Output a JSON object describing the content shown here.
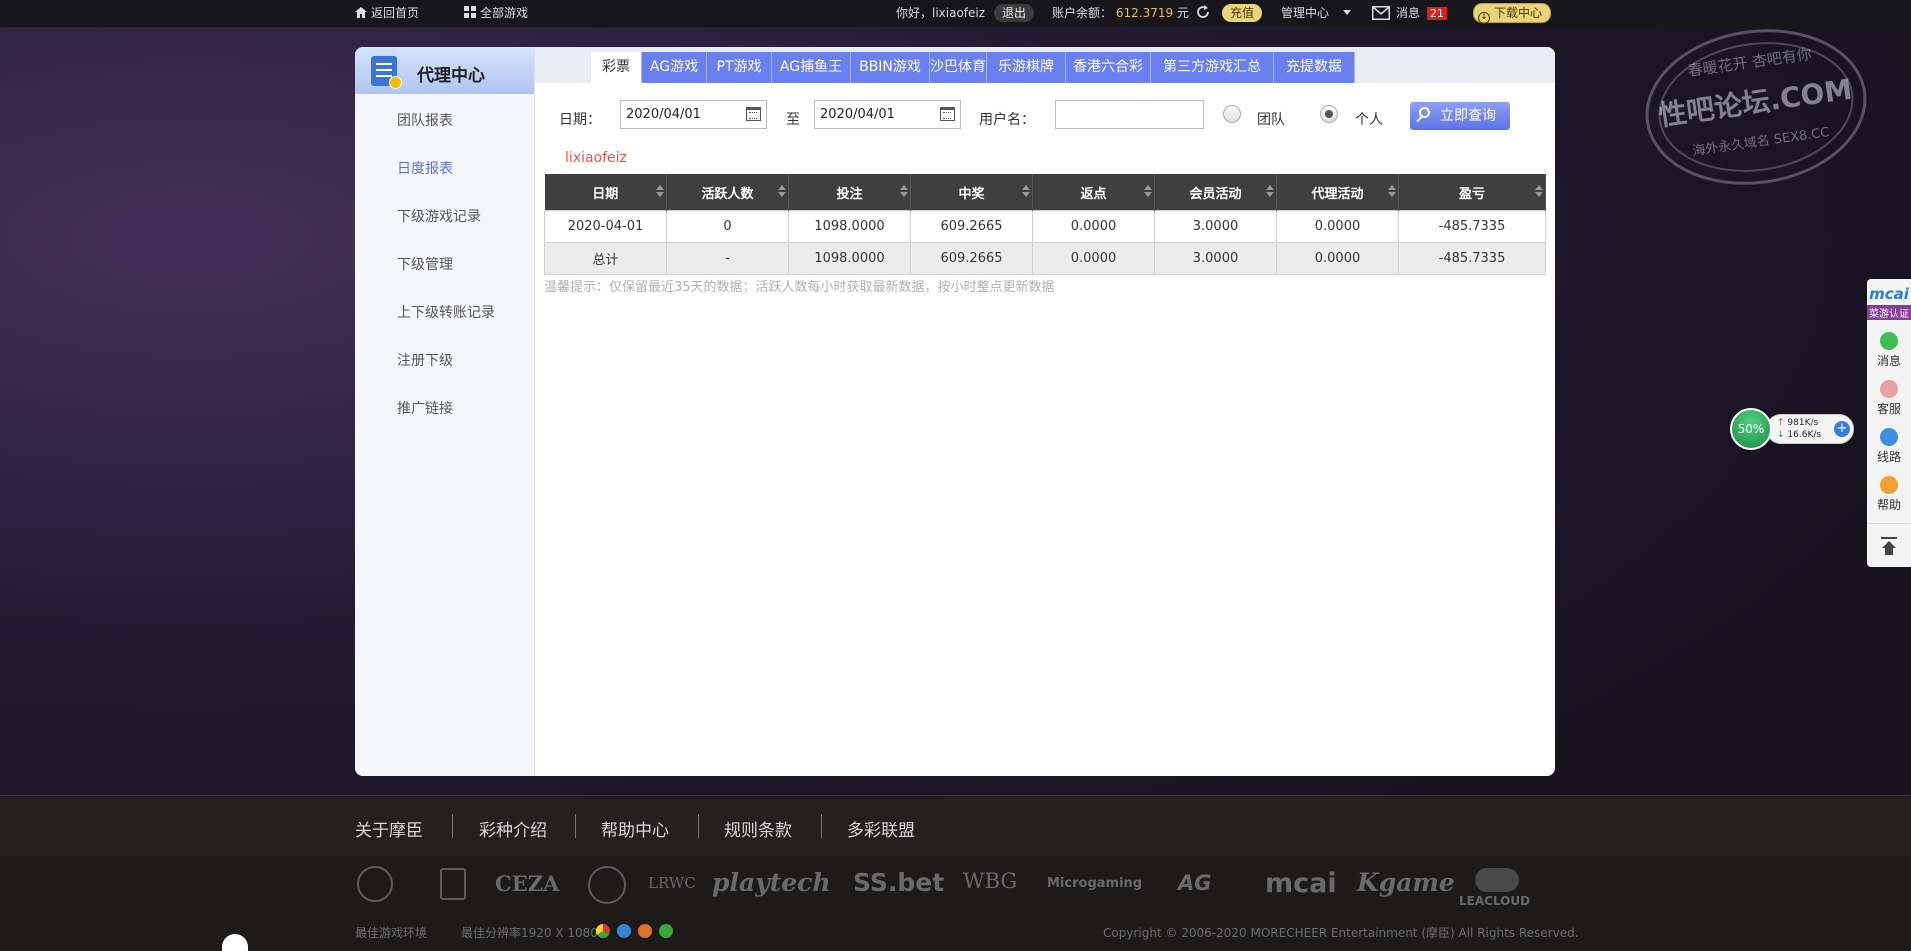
{
  "topbar": {
    "home": "返回首页",
    "all_games": "全部游戏",
    "greeting": "你好，lixiaofeiz",
    "logout": "退出",
    "balance_label": "账户余额：",
    "balance_value": "612.3719",
    "balance_unit": "元",
    "recharge": "充值",
    "manage": "管理中心",
    "messages_label": "消息",
    "messages_count": "21",
    "download": "下载中心"
  },
  "sidebar": {
    "title": "代理中心",
    "items": [
      {
        "label": "团队报表"
      },
      {
        "label": "日度报表"
      },
      {
        "label": "下级游戏记录"
      },
      {
        "label": "下级管理"
      },
      {
        "label": "上下级转账记录"
      },
      {
        "label": "注册下级"
      },
      {
        "label": "推广链接"
      }
    ],
    "active_index": 1
  },
  "tabs": [
    {
      "label": "彩票"
    },
    {
      "label": "AG游戏"
    },
    {
      "label": "PT游戏"
    },
    {
      "label": "AG捕鱼王"
    },
    {
      "label": "BBIN游戏"
    },
    {
      "label": "沙巴体育"
    },
    {
      "label": "乐游棋牌"
    },
    {
      "label": "香港六合彩"
    },
    {
      "label": "第三方游戏汇总"
    },
    {
      "label": "充提数据"
    }
  ],
  "filters": {
    "date_label": "日期：",
    "date_from": "2020/04/01",
    "to_label": "至",
    "date_to": "2020/04/01",
    "username_label": "用户名：",
    "username_value": "",
    "team_label": "团队",
    "personal_label": "个人",
    "selected": "personal",
    "query_button": "立即查询"
  },
  "username_tag": "lixiaofeiz",
  "table": {
    "headers": [
      "日期",
      "活跃人数",
      "投注",
      "中奖",
      "返点",
      "会员活动",
      "代理活动",
      "盈亏"
    ],
    "rows": [
      [
        "2020-04-01",
        "0",
        "1098.0000",
        "609.2665",
        "0.0000",
        "3.0000",
        "0.0000",
        "-485.7335"
      ]
    ],
    "total_row": [
      "总计",
      "-",
      "1098.0000",
      "609.2665",
      "0.0000",
      "3.0000",
      "0.0000",
      "-485.7335"
    ]
  },
  "tip": "温馨提示：仅保留最近35天的数据；活跃人数每小时获取最新数据，按小时整点更新数据",
  "footer": {
    "links": [
      "关于摩臣",
      "彩种介绍",
      "帮助中心",
      "规则条款",
      "多彩联盟"
    ],
    "partners": [
      "CEZA",
      "LRWC",
      "playtech",
      "SS.bet",
      "WBG",
      "Microgaming",
      "AG",
      "mcai",
      "Kgame",
      "LEACLOUD"
    ],
    "best_env": "最佳游戏环境",
    "best_resolution": "最佳分辨率1920 X 1080",
    "copyright": "Copyright © 2006-2020 MORECHEER Entertainment (摩臣) All Rights Reserved."
  },
  "watermark": {
    "top": "春暖花开 杏吧有你",
    "main": "性吧论坛.COM",
    "bottom": "海外永久域名 SEX8.CC"
  },
  "right_rail": {
    "brand": "mcai",
    "brand_sub": "菜游认证",
    "items": [
      "消息",
      "客服",
      "线路",
      "帮助"
    ]
  },
  "speed_widget": {
    "percent": "50%",
    "up": "981K/s",
    "down": "16.6K/s"
  }
}
